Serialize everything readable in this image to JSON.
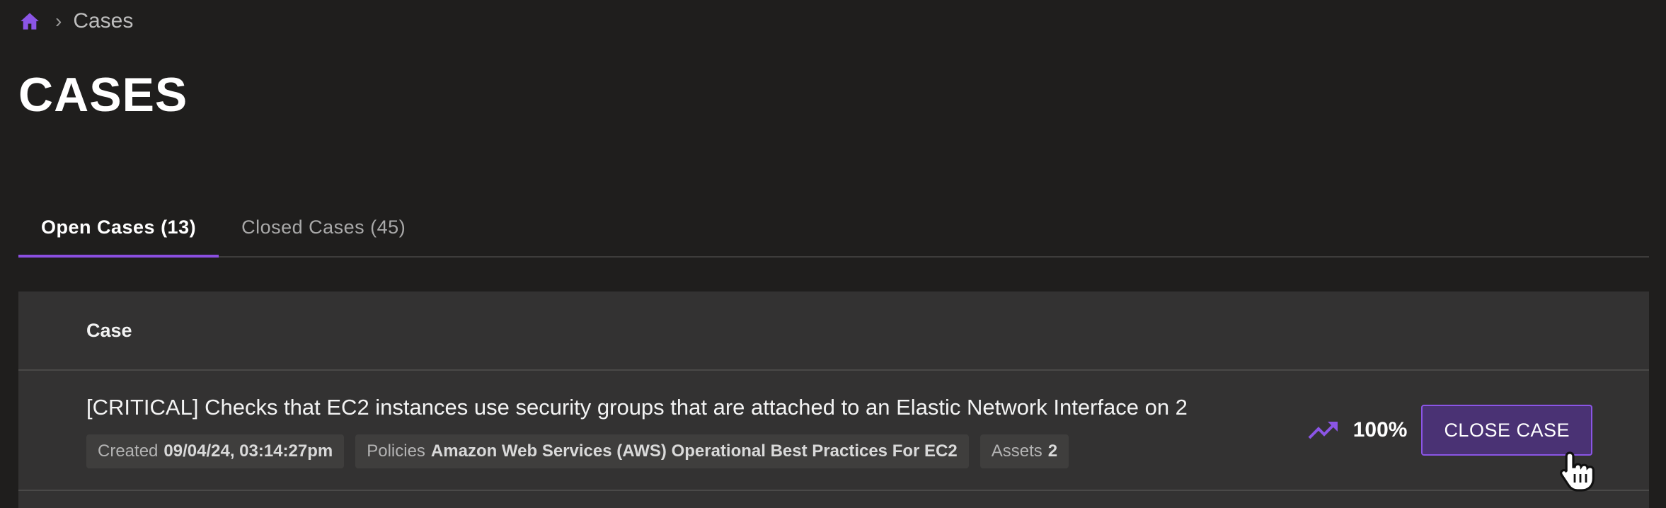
{
  "breadcrumb": {
    "home_icon": "home-icon",
    "separator": "›",
    "current": "Cases"
  },
  "page": {
    "title": "CASES"
  },
  "tabs": [
    {
      "label": "Open Cases (13)",
      "active": true
    },
    {
      "label": "Closed Cases (45)",
      "active": false
    }
  ],
  "table": {
    "header": "Case",
    "rows": [
      {
        "title": "[CRITICAL] Checks that EC2 instances use security groups that are attached to an Elastic Network Interface on 2",
        "created_label": "Created",
        "created_value": "09/04/24, 03:14:27pm",
        "policies_label": "Policies",
        "policies_value": "Amazon Web Services (AWS) Operational Best Practices For EC2",
        "assets_label": "Assets",
        "assets_value": "2",
        "trend_icon": "trending-up-icon",
        "percent": "100%",
        "action_label": "CLOSE CASE"
      }
    ]
  },
  "colors": {
    "accent": "#8b4fe0",
    "button_bg": "#4a3274",
    "background": "#1f1e1d",
    "table_bg": "#333232"
  }
}
